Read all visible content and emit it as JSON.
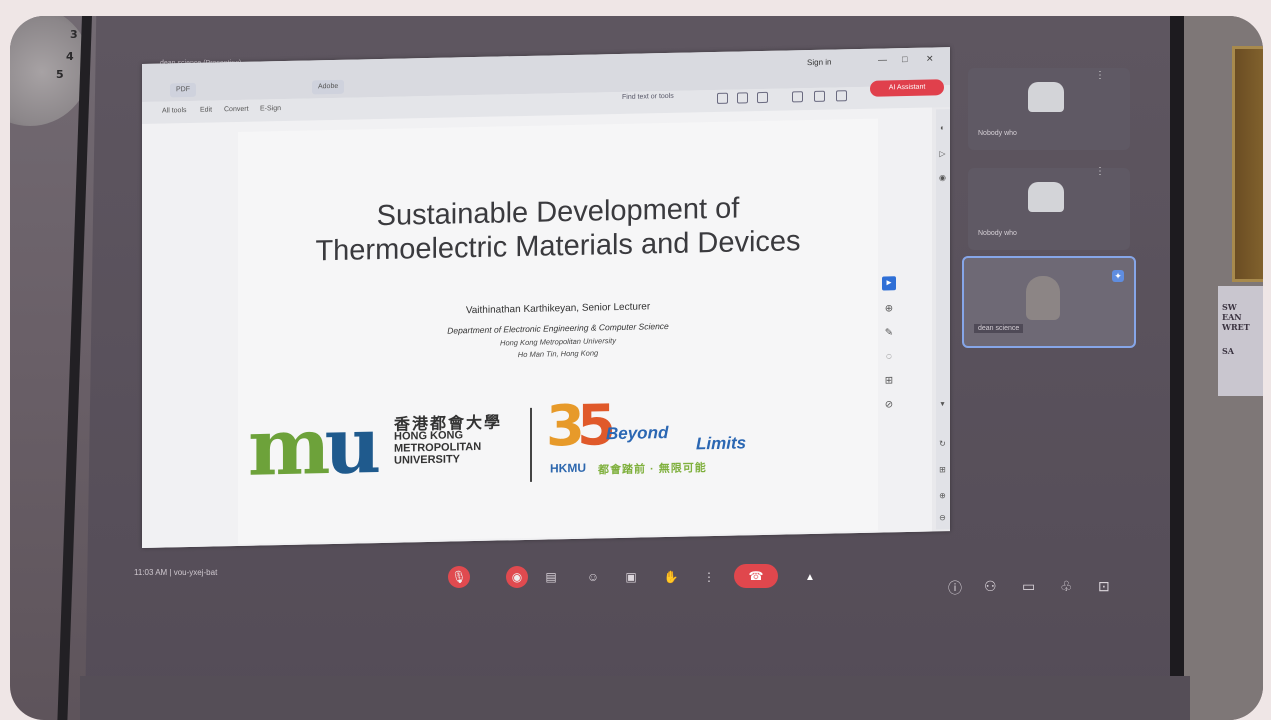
{
  "clock": {
    "numbers": [
      "3",
      "4",
      "5"
    ]
  },
  "wall_sign": {
    "lines": [
      "SW",
      "EAN",
      "WRET",
      "SA"
    ]
  },
  "window": {
    "address": "dean science (Presenting)",
    "tab1": "PDF",
    "tab2": "Adobe",
    "sign_in": "Sign in",
    "controls": [
      "—",
      "□",
      "✕"
    ],
    "menu": [
      "All tools",
      "Edit",
      "Convert",
      "E-Sign"
    ],
    "find_text": "Find text or tools",
    "ai_button": "AI Assistant"
  },
  "slide": {
    "title_line1": "Sustainable Development of",
    "title_line2": "Thermoelectric Materials and Devices",
    "author": "Vaithinathan Karthikeyan, Senior Lecturer",
    "department": "Department of Electronic Engineering & Computer Science",
    "university": "Hong Kong Metropolitan University",
    "address": "Ho Man Tin, Hong Kong",
    "logo_chinese": "香港都會大學",
    "logo_en_lines": [
      "HONG KONG",
      "METROPOLITAN",
      "UNIVERSITY"
    ],
    "logo_35": [
      "3",
      "5"
    ],
    "beyond": "Beyond",
    "limits": "Limits",
    "hkmu": "HKMU",
    "hkmu_cn": "都會踏前 · 無限可能"
  },
  "participants": [
    {
      "name": "Nobody who"
    },
    {
      "name": "Nobody who"
    },
    {
      "name": "dean science"
    }
  ],
  "meeting": {
    "info": "11:03 AM | vou-yxej-bat"
  }
}
